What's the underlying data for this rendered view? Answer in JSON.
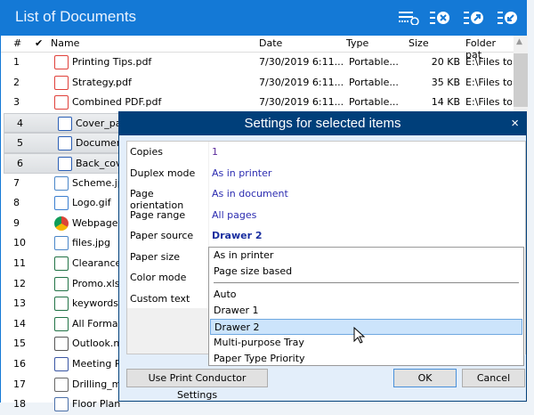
{
  "window": {
    "title": "List of Documents",
    "toolbar_icons": [
      "clear-list-icon",
      "remove-item-icon",
      "export-list-icon",
      "import-list-icon"
    ]
  },
  "columns": {
    "num": "#",
    "check": "✔",
    "name": "Name",
    "date": "Date",
    "type": "Type",
    "size": "Size",
    "folder": "Folder pat"
  },
  "rows": [
    {
      "num": "1",
      "icon": "pdf",
      "name": "Printing Tips.pdf",
      "date": "7/30/2019 6:11...",
      "type": "Portable...",
      "size": "20 KB",
      "folder": "E:\\Files to"
    },
    {
      "num": "2",
      "icon": "pdf",
      "name": "Strategy.pdf",
      "date": "7/30/2019 6:11...",
      "type": "Portable...",
      "size": "35 KB",
      "folder": "E:\\Files to"
    },
    {
      "num": "3",
      "icon": "pdf",
      "name": "Combined PDF.pdf",
      "date": "7/30/2019 6:11...",
      "type": "Portable...",
      "size": "14 KB",
      "folder": "E:\\Files to"
    },
    {
      "num": "4",
      "icon": "word",
      "name": "Cover_pag",
      "selected": true
    },
    {
      "num": "5",
      "icon": "word",
      "name": "Documen",
      "selected": true
    },
    {
      "num": "6",
      "icon": "word",
      "name": "Back_cove",
      "selected": true
    },
    {
      "num": "7",
      "icon": "image",
      "name": "Scheme.jp"
    },
    {
      "num": "8",
      "icon": "gif",
      "name": "Logo.gif"
    },
    {
      "num": "9",
      "icon": "chrome",
      "name": "Webpage."
    },
    {
      "num": "10",
      "icon": "image",
      "name": "files.jpg"
    },
    {
      "num": "11",
      "icon": "excel",
      "name": "Clearance."
    },
    {
      "num": "12",
      "icon": "excel",
      "name": "Promo.xls"
    },
    {
      "num": "13",
      "icon": "excel",
      "name": "keywords."
    },
    {
      "num": "14",
      "icon": "excel",
      "name": "All Format"
    },
    {
      "num": "15",
      "icon": "mail",
      "name": "Outlook.m"
    },
    {
      "num": "16",
      "icon": "visio",
      "name": "Meeting R"
    },
    {
      "num": "17",
      "icon": "dxf",
      "name": "Drilling_m"
    },
    {
      "num": "18",
      "icon": "plan",
      "name": "Floor Plan"
    }
  ],
  "dialog": {
    "title": "Settings for selected items",
    "close": "×",
    "properties": [
      {
        "label": "Copies",
        "value": "1"
      },
      {
        "label": "Duplex mode",
        "value": "As in printer"
      },
      {
        "label": "Page orientation",
        "value": "As in document"
      },
      {
        "label": "Page range",
        "value": "All pages"
      },
      {
        "label": "Paper source",
        "value": "Drawer 2"
      },
      {
        "label": "Paper size"
      },
      {
        "label": "Color mode"
      },
      {
        "label": "Custom text"
      }
    ],
    "dropdown": {
      "options": [
        "As in printer",
        "Page size based",
        "Auto",
        "Drawer 1",
        "Drawer 2",
        "Multi-purpose Tray",
        "Paper Type Priority"
      ],
      "highlighted": "Drawer 2"
    },
    "buttons": {
      "use_settings": "Use Print Conductor Settings",
      "ok": "OK",
      "cancel": "Cancel"
    }
  },
  "colors": {
    "titlebar": "#1479d6",
    "dialog_title": "#003f7a",
    "value_text": "#2b2bb0",
    "highlight": "#cce4fb"
  }
}
